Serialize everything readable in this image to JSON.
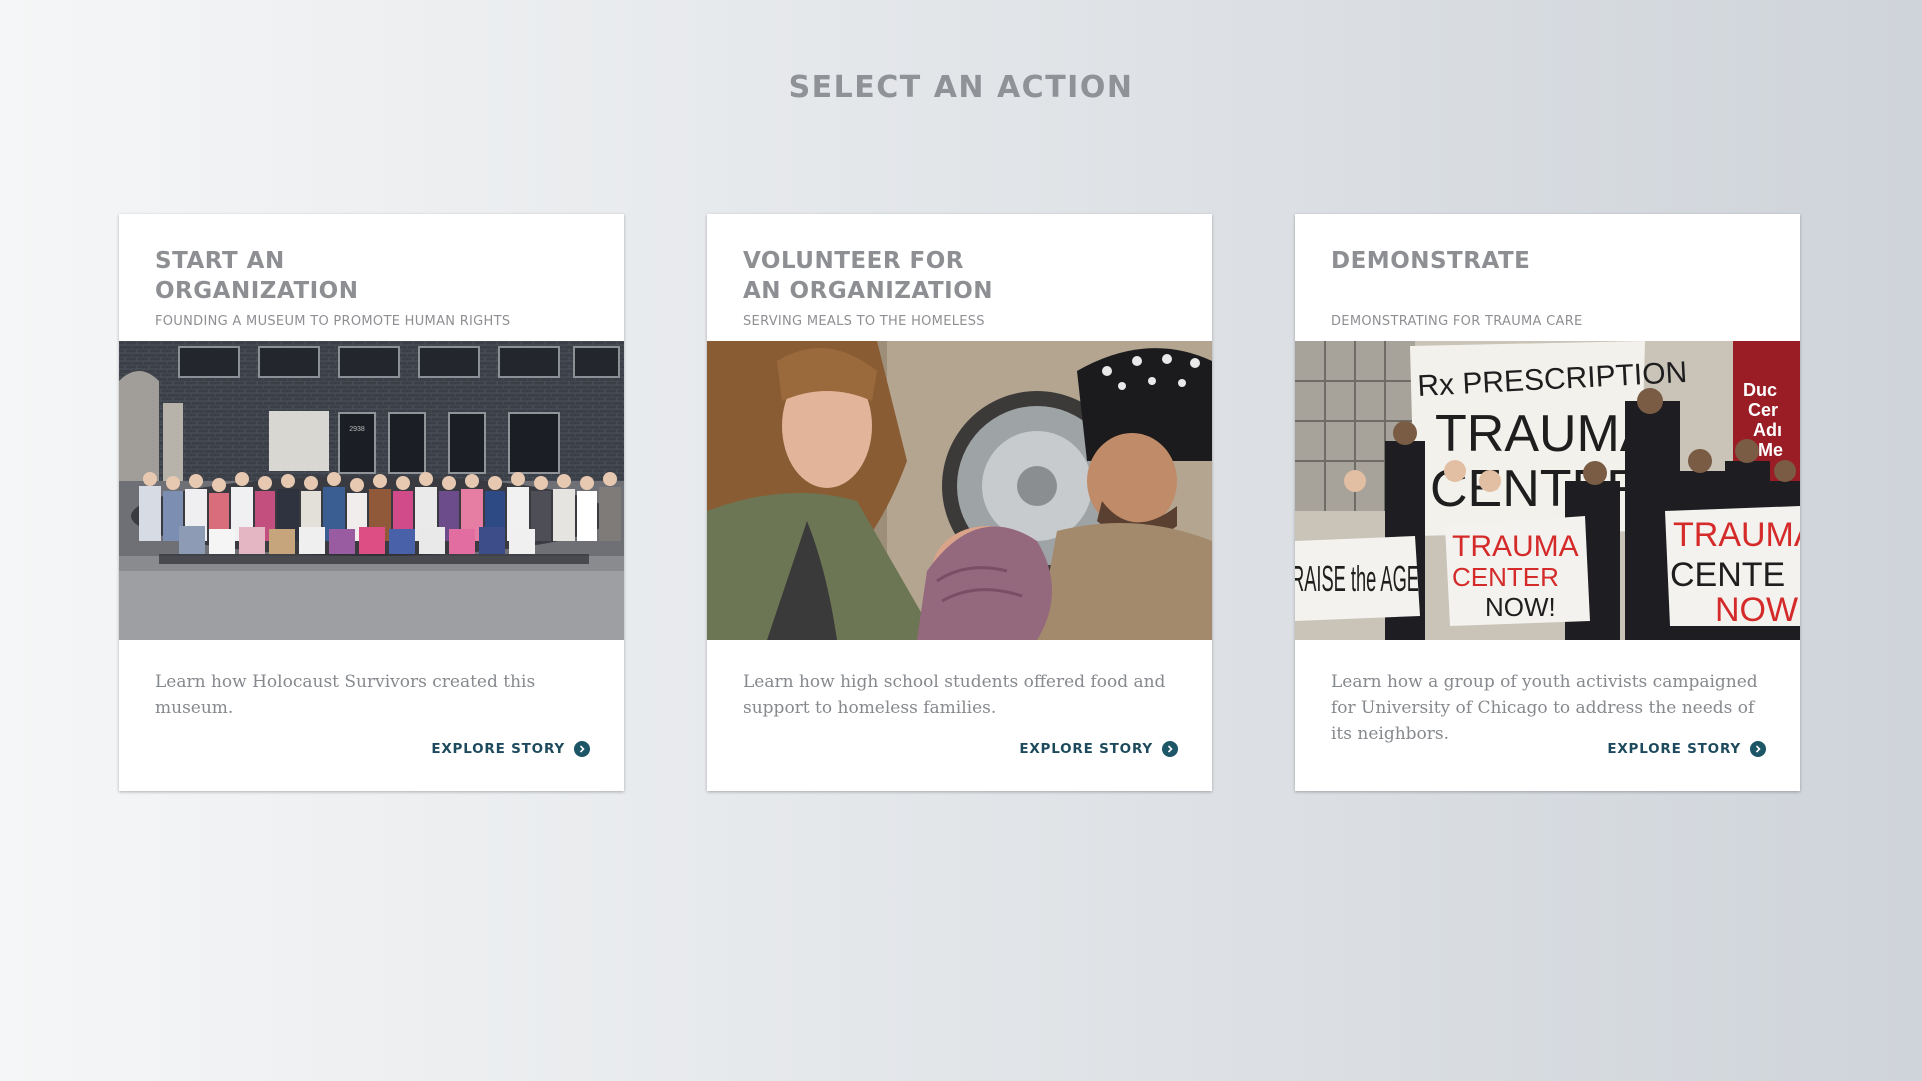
{
  "page": {
    "title": "SELECT AN ACTION"
  },
  "cards": [
    {
      "title": "START AN\nORGANIZATION",
      "subtitle": "FOUNDING A MUSEUM TO PROMOTE HUMAN RIGHTS",
      "photo_icon": "group-photo-icon",
      "photo_signs": [
        "2938"
      ],
      "description": "Learn how Holocaust Survivors created this museum.",
      "cta_label": "EXPLORE STORY",
      "cta_icon": "chevron-right-circle-icon"
    },
    {
      "title": "VOLUNTEER FOR\nAN ORGANIZATION",
      "subtitle": "SERVING MEALS TO THE HOMELESS",
      "photo_icon": "volunteers-photo-icon",
      "description": "Learn how high school students offered food and support to homeless families.",
      "cta_label": "EXPLORE STORY",
      "cta_icon": "chevron-right-circle-icon"
    },
    {
      "title": "DEMONSTRATE",
      "subtitle": "DEMONSTRATING FOR TRAUMA CARE",
      "photo_icon": "protest-photo-icon",
      "photo_signs": [
        "Rx PRESCRIPTION",
        "TRAUMA",
        "CENTER",
        "TRAUMA",
        "CENTER",
        "NOW!",
        "RAISE the AGE",
        "TRAUMA",
        "CENTE",
        "NOW",
        "Duc",
        "Cer",
        "Adı",
        "Me"
      ],
      "description": "Learn how a group of youth activists campaigned for University of Chicago to address the needs of its neighbors.",
      "cta_label": "EXPLORE STORY",
      "cta_icon": "chevron-right-circle-icon"
    }
  ],
  "colors": {
    "title_gray": "#8f9296",
    "cta_teal": "#1d4a5c",
    "card_bg": "#ffffff"
  }
}
